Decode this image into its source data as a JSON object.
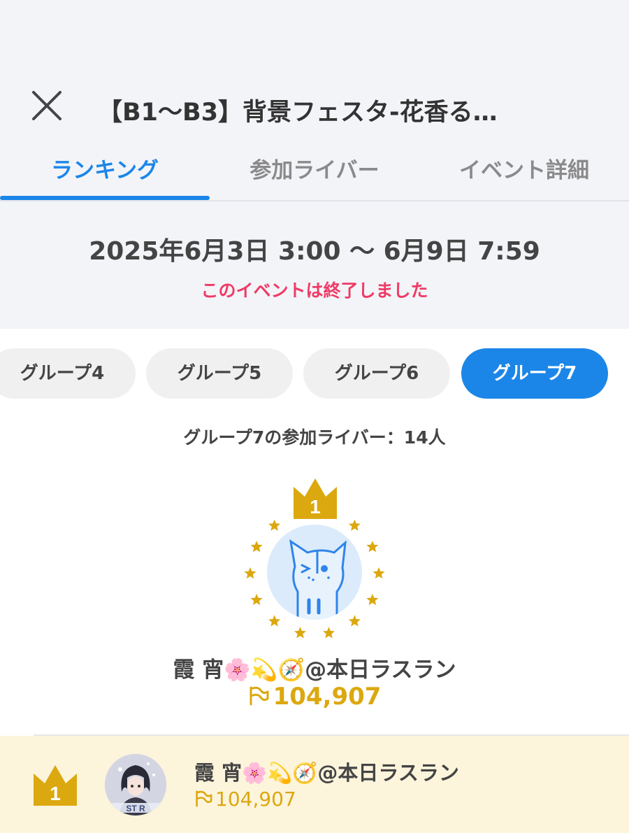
{
  "header": {
    "title": "【B1〜B3】背景フェスタ-花香る…",
    "close_icon": "close-icon"
  },
  "tabs": [
    {
      "label": "ランキング",
      "active": true
    },
    {
      "label": "参加ライバー",
      "active": false
    },
    {
      "label": "イベント詳細",
      "active": false
    }
  ],
  "event": {
    "period": "2025年6月3日 3:00 〜 6月9日 7:59",
    "status": "このイベントは終了しました"
  },
  "groups": [
    {
      "label": "グループ4",
      "active": false
    },
    {
      "label": "グループ5",
      "active": false
    },
    {
      "label": "グループ6",
      "active": false
    },
    {
      "label": "グループ7",
      "active": true
    }
  ],
  "participants_text": "グループ7の参加ライバー：14人",
  "top_rank": {
    "rank": "1",
    "name": "霞 宵🌸💫🧭@本日ラスラン",
    "score": "104,907"
  },
  "ranking": [
    {
      "rank": "1",
      "name": "霞 宵🌸💫🧭@本日ラスラン",
      "score": "104,907"
    }
  ],
  "colors": {
    "accent": "#1b86e8",
    "gold": "#dca80f",
    "ended": "#ef3a66",
    "highlight_row": "#fdf4dc"
  }
}
